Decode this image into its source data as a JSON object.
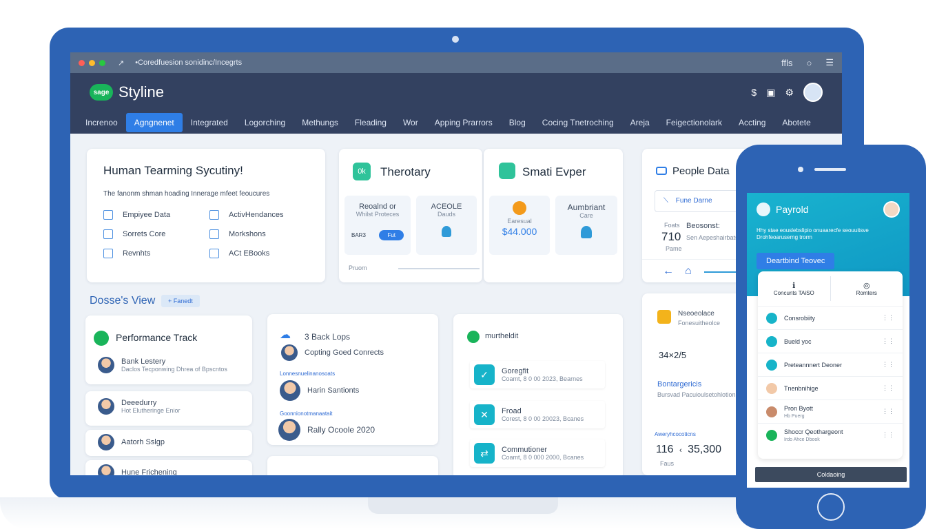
{
  "titlebar": {
    "url": "•Coredfuesion sonidinc/Incegrts",
    "right_text": "ffls"
  },
  "app": {
    "logo": "sage",
    "brand": "Styline"
  },
  "nav": [
    "Increnoo",
    "Agngnenet",
    "Integrated",
    "Logorching",
    "Methungs",
    "Fleading",
    "Wor",
    "Apping Prarrors",
    "Blog",
    "Cocing Tnetroching",
    "Areja",
    "Feigectionolark",
    "Accting",
    "Abotete"
  ],
  "hero": {
    "title": "Human Tearming Sycutiny!",
    "subtitle": "The fanonm shman hoading Innerage mfeet feoucures",
    "features": [
      "Empiyee Data",
      "ActivHendances",
      "Sorrets Core",
      "Morkshons",
      "Revnhts",
      "ACt EBooks"
    ]
  },
  "theroary": {
    "title": "Therotary",
    "badge": "0k",
    "box1": {
      "title": "Reoalnd or",
      "sub": "Whilst Proteces",
      "field": "BAR3",
      "button": "Fut"
    },
    "box2": {
      "title": "ACEOLE",
      "sub": "Dauds"
    },
    "scrub_label": "Pruom"
  },
  "smart": {
    "title": "Smati Evper",
    "box1": {
      "sub": "Earesual",
      "value": "$44.000"
    },
    "box2": {
      "title": "Aumbriant",
      "sub": "Care"
    }
  },
  "people": {
    "title": "People Data",
    "search": "Fune Darne",
    "stat_small": "Foats",
    "stat_value": "710",
    "stat_label": "Pame",
    "detail_title": "Beosonst:",
    "detail_sub": "Sen Aepeshairbats"
  },
  "section": {
    "title": "Dosse's View",
    "tag": "Fanedt"
  },
  "perf": {
    "title": "Performance Track",
    "people": [
      {
        "name": "Bank Lestery",
        "sub": "Daclos Tecponwing Dhrea of Bpscntos"
      },
      {
        "name": "Deeedurry",
        "sub": "Hot Elutheringe Enior"
      },
      {
        "name": "Aatorh Sslgp",
        "sub": ""
      },
      {
        "name": "Hune Frichening",
        "sub": ""
      }
    ]
  },
  "backlops": {
    "title": "3 Back Lops",
    "item1": "Copting Goed Conrects",
    "label2": "Lonnesnuelinanosoats",
    "item2": "Harin Santionts",
    "label3": "Goonnionotmanaatait",
    "item3": "Rally Ocoole 2020"
  },
  "multi": {
    "title": "murtheldit",
    "items": [
      {
        "title": "Goregfit",
        "sub": "Coamt, 8 0 00 2023, Bearnes"
      },
      {
        "title": "Froad",
        "sub": "Corest, 8 0 00 20023, Bcanes"
      },
      {
        "title": "Commutioner",
        "sub": "Coamt, 8 0 000 2000, Bcanes"
      }
    ]
  },
  "side": {
    "item1_title": "Nseoeolace",
    "item1_sub": "Fonesuitheolce",
    "ratio": "34×2/5",
    "item2_title": "Bontargericis",
    "item2_sub": "Bursvad Pacuioulsetohlotion",
    "label": "Aweryhcocoticns",
    "num_left": "116",
    "num_sep": "‹",
    "num_right": "35,300",
    "num_sub": "Faus"
  },
  "phone": {
    "title": "Payrold",
    "desc": "Hhy stae eouslebslipio onuaarecfe seouuitsve Drohfeoaruserng trorm",
    "cta": "Deartbind Teovec",
    "col1": "Concunts TAiSO",
    "col2": "Romters",
    "rows": [
      "Consrobiity",
      "Bueld yoc",
      "Preteannnert Deoner",
      "Tnenbnihige",
      "Pron Byott",
      "Shoccr Qeothargeont"
    ],
    "row_sub5": "Hb Puerg",
    "row_sub6": "Irdo Ahce Dbook",
    "bottom": "Coldaoing"
  },
  "colors": {
    "frame": "#2d63b4",
    "appbar": "#334160",
    "accent": "#2f7ee6",
    "teal": "#16b3c9"
  }
}
